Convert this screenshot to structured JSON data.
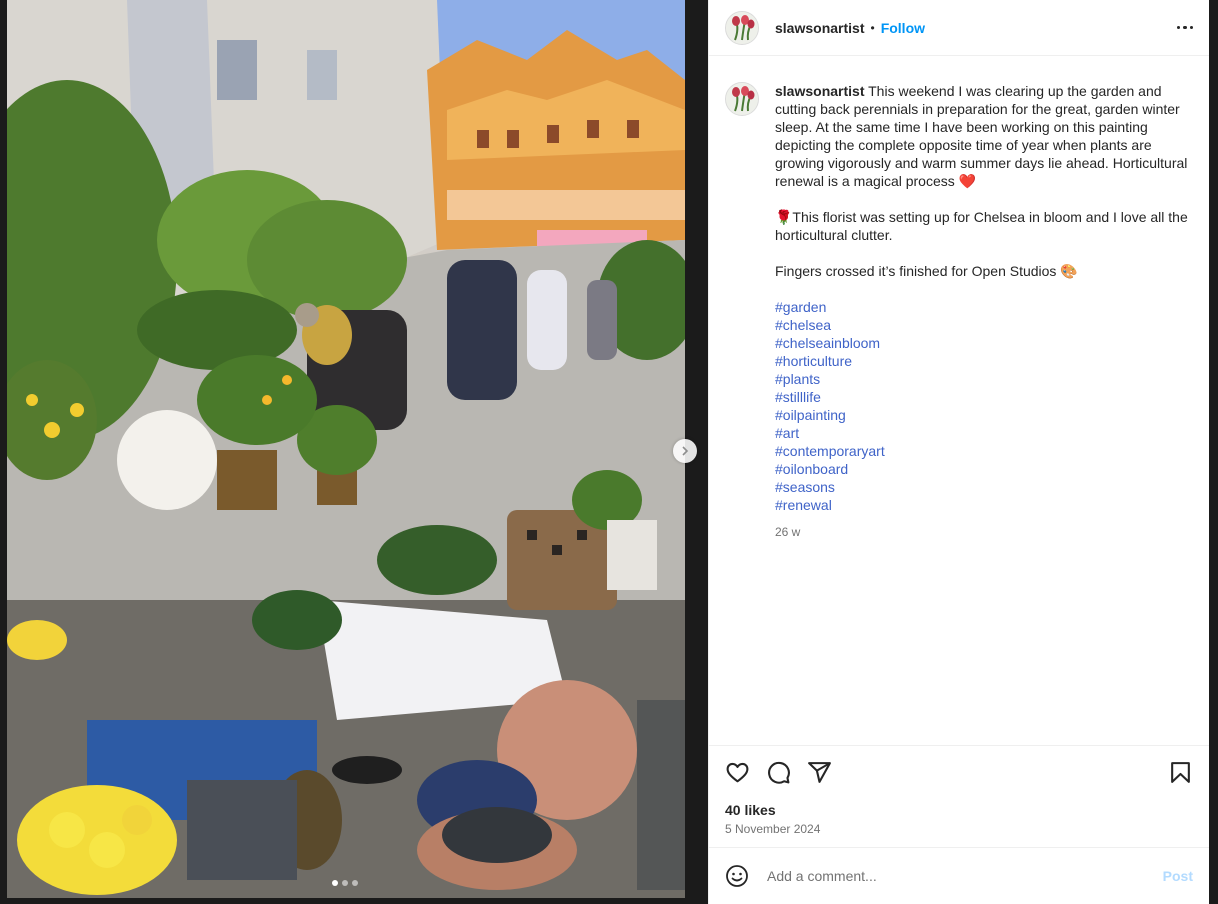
{
  "post": {
    "username": "slawsonartist",
    "separator": "•",
    "follow_label": "Follow",
    "caption": {
      "username": "slawsonartist",
      "text_1": "This weekend I was clearing up the garden and cutting back perennials in preparation for the great, garden winter sleep. At the same time I have been working on this painting depicting the complete opposite time of year when plants are growing vigorously and warm summer days lie ahead. Horticultural renewal is a magical process ❤️",
      "text_2": "🌹This florist was setting up for Chelsea in bloom and I love all the horticultural clutter.",
      "text_3": "Fingers crossed it’s finished for Open Studios 🎨",
      "hashtags": [
        "#garden",
        "#chelsea",
        "#chelseainbloom",
        "#horticulture",
        "#plants",
        "#stilllife",
        "#oilpainting",
        "#art",
        "#contemporaryart",
        "#oilonboard",
        "#seasons",
        "#renewal"
      ],
      "time": "26 w"
    },
    "likes": "40 likes",
    "date": "5 November 2024",
    "comment_placeholder": "Add a comment...",
    "post_label": "Post",
    "carousel": {
      "slide_count": 3,
      "active_index": 0
    },
    "icons": {
      "more": "more-options-icon",
      "like": "heart-icon",
      "comment": "comment-icon",
      "share": "share-icon",
      "save": "bookmark-icon",
      "emoji": "emoji-icon",
      "next": "chevron-right-icon"
    },
    "colors": {
      "link": "#0095f6",
      "hashtag": "#3f63c8",
      "muted": "#737373",
      "post_disabled": "#b3dbff"
    }
  }
}
